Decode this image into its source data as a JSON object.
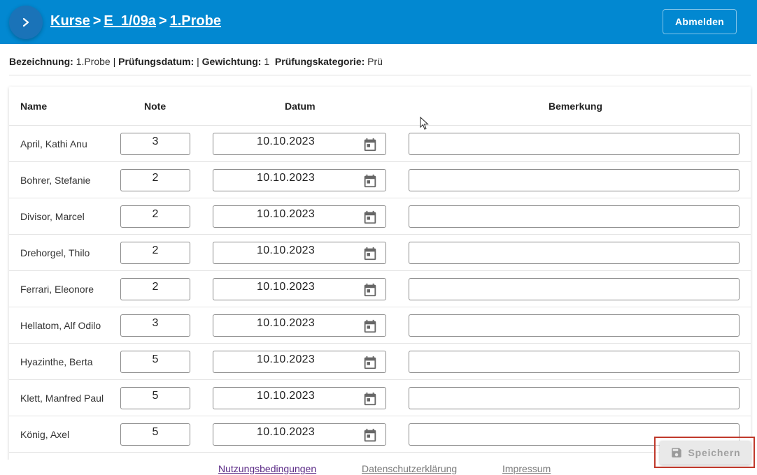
{
  "header": {
    "breadcrumb": [
      "Kurse",
      "E_1/09a",
      "1.Probe"
    ],
    "separator": ">",
    "logout_label": "Abmelden",
    "bg_color": "#0288d1"
  },
  "info": {
    "bezeichnung_label": "Bezeichnung:",
    "bezeichnung_value": "1.Probe",
    "pruefungsdatum_label": "Prüfungsdatum:",
    "pruefungsdatum_value": "",
    "gewichtung_label": "Gewichtung:",
    "gewichtung_value": "1",
    "kategorie_label": "Prüfungskategorie:",
    "kategorie_value": "Prü",
    "pipe": "|"
  },
  "table": {
    "columns": [
      "Name",
      "Note",
      "Datum",
      "Bemerkung"
    ],
    "rows": [
      {
        "name": "April, Kathi Anu",
        "note": "3",
        "datum": "10.10.2023",
        "bemerkung": ""
      },
      {
        "name": "Bohrer, Stefanie",
        "note": "2",
        "datum": "10.10.2023",
        "bemerkung": ""
      },
      {
        "name": "Divisor, Marcel",
        "note": "2",
        "datum": "10.10.2023",
        "bemerkung": ""
      },
      {
        "name": "Drehorgel, Thilo",
        "note": "2",
        "datum": "10.10.2023",
        "bemerkung": ""
      },
      {
        "name": "Ferrari, Eleonore",
        "note": "2",
        "datum": "10.10.2023",
        "bemerkung": ""
      },
      {
        "name": "Hellatom, Alf Odilo",
        "note": "3",
        "datum": "10.10.2023",
        "bemerkung": ""
      },
      {
        "name": "Hyazinthe, Berta",
        "note": "5",
        "datum": "10.10.2023",
        "bemerkung": ""
      },
      {
        "name": "Klett, Manfred Paul",
        "note": "5",
        "datum": "10.10.2023",
        "bemerkung": ""
      },
      {
        "name": "König, Axel",
        "note": "5",
        "datum": "10.10.2023",
        "bemerkung": ""
      }
    ]
  },
  "save_label": "Speichern",
  "footer": {
    "links": [
      "Nutzungsbedingungen",
      "Datenschutzerklärung",
      "Impressum"
    ]
  },
  "icons": {
    "menu": "chevron-right-icon",
    "calendar": "calendar-icon",
    "save": "floppy-disk-icon"
  }
}
